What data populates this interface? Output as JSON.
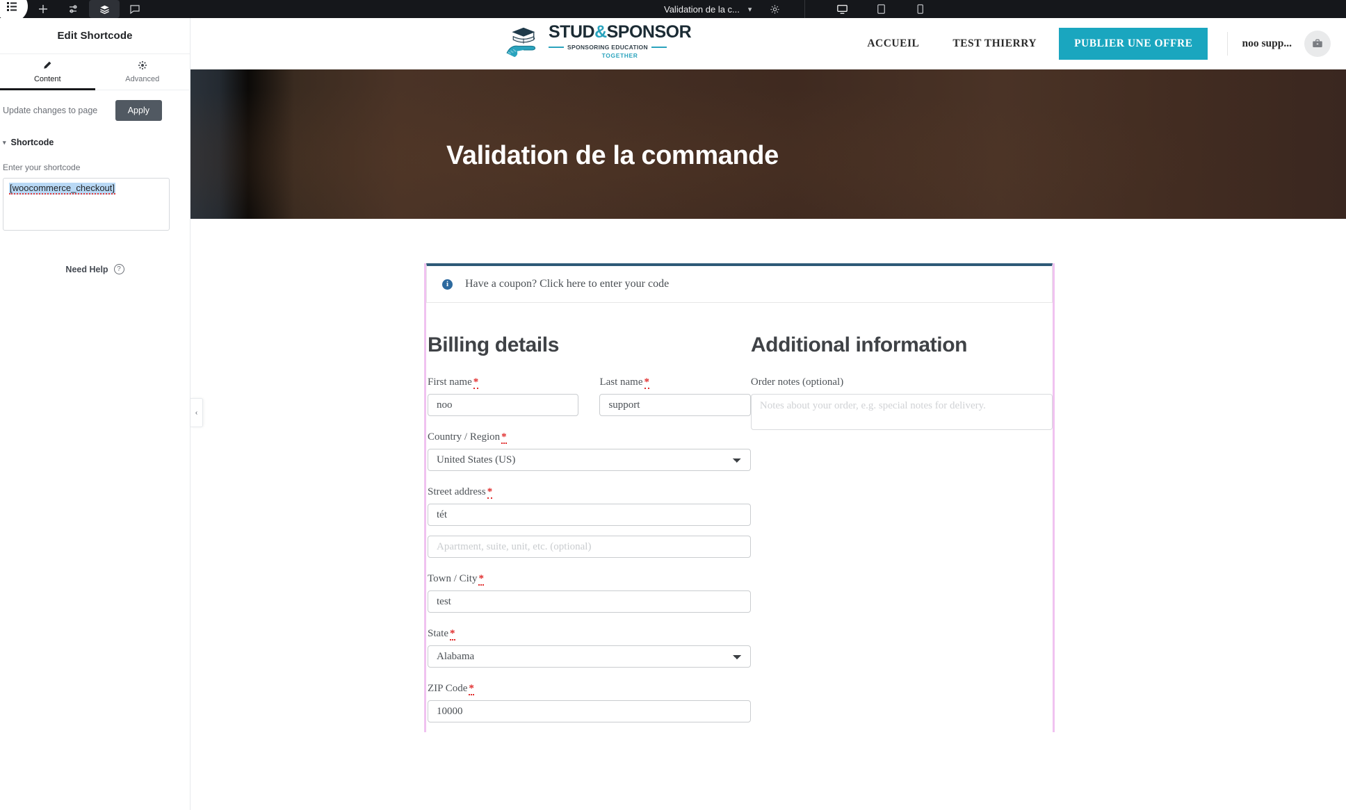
{
  "editor": {
    "topbar": {
      "icons": [
        "menu-icon",
        "add-element-icon",
        "settings-sliders-icon",
        "structure-layers-icon",
        "comments-icon"
      ],
      "document_title": "Validation de la c...",
      "chevron": "▾",
      "preview_settings_icon": "gear-icon",
      "devices": [
        {
          "name": "desktop",
          "glyph": "🖥",
          "active": true
        },
        {
          "name": "tablet",
          "glyph": "▭",
          "active": false
        },
        {
          "name": "mobile",
          "glyph": "▯",
          "active": false
        }
      ]
    },
    "panel": {
      "title": "Edit Shortcode",
      "tabs": [
        {
          "label": "Content",
          "icon": "pencil-icon",
          "active": true
        },
        {
          "label": "Advanced",
          "icon": "gear-icon",
          "active": false
        }
      ],
      "apply_notice": "Update changes to page",
      "apply_label": "Apply",
      "section_title": "Shortcode",
      "section_caret": "▾",
      "field_label": "Enter your shortcode",
      "shortcode_value": "[woocommerce_checkout]",
      "need_help": "Need Help",
      "need_help_icon": "?",
      "collapse_arrow": "‹"
    }
  },
  "site": {
    "logo": {
      "main_a": "STUD",
      "amp": "&",
      "main_b": "SPONSOR",
      "tagline": "SPONSORING EDUCATION",
      "tagline2": "TOGETHER"
    },
    "nav": [
      {
        "label": "ACCUEIL"
      },
      {
        "label": "TEST THIERRY"
      }
    ],
    "cta_label": "PUBLIER UNE OFFRE",
    "user_name": "noo supp...",
    "user_avatar_icon": "briefcase-icon",
    "hero_title": "Validation de la commande"
  },
  "checkout": {
    "coupon": {
      "icon": "info-icon",
      "text": "Have a coupon? Click here to enter your code"
    },
    "billing": {
      "title": "Billing details",
      "required_mark": "*",
      "fields": {
        "first_name": {
          "label": "First name",
          "value": "noo",
          "required": true
        },
        "last_name": {
          "label": "Last name",
          "value": "support",
          "required": true
        },
        "country": {
          "label": "Country / Region",
          "value": "United States (US)",
          "required": true
        },
        "street": {
          "label": "Street address",
          "value": "tét",
          "required": true
        },
        "street2": {
          "label": "",
          "value": "",
          "placeholder": "Apartment, suite, unit, etc. (optional)",
          "required": false
        },
        "city": {
          "label": "Town / City",
          "value": "test",
          "required": true
        },
        "state": {
          "label": "State",
          "value": "Alabama",
          "required": true
        },
        "zip": {
          "label": "ZIP Code",
          "value": "10000",
          "required": true
        }
      }
    },
    "additional": {
      "title": "Additional information",
      "order_notes_label": "Order notes (optional)",
      "order_notes_value": "",
      "order_notes_placeholder": "Notes about your order, e.g. special notes for delivery."
    }
  },
  "colors": {
    "brand_teal": "#1aa6bf",
    "editor_dark": "#15171b",
    "apply_button": "#515962",
    "required_red": "#e02b2b",
    "selection_pink": "#f0c2f0",
    "coupon_border": "#2d5a77"
  }
}
